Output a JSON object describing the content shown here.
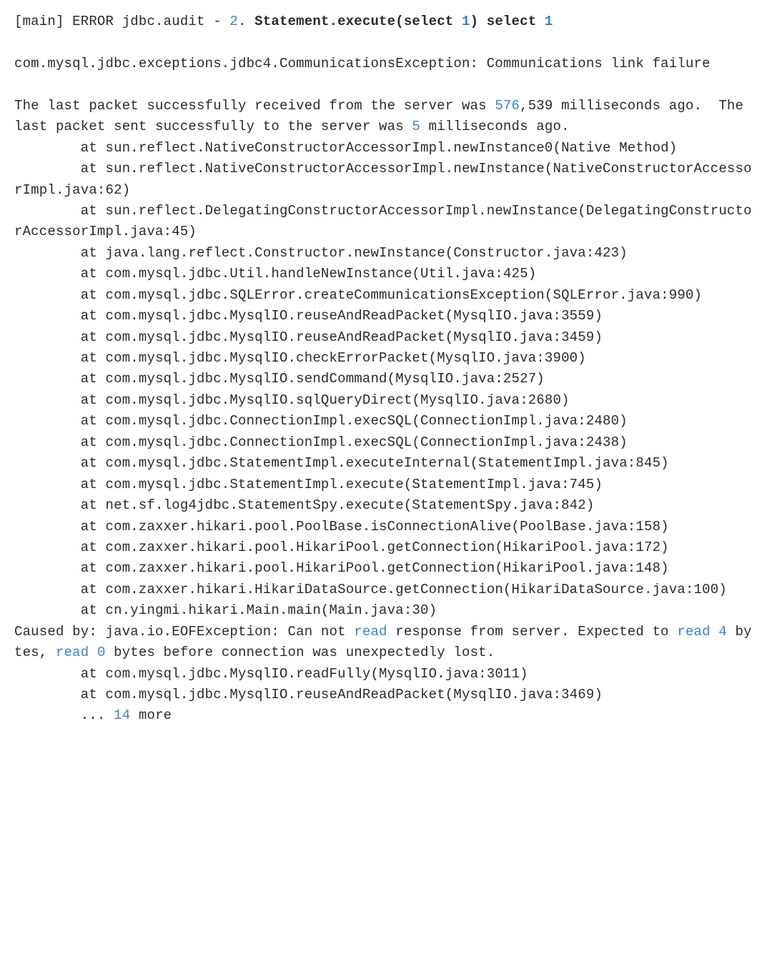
{
  "log": {
    "header": {
      "prefix": "[main] ERROR jdbc.audit - ",
      "num": "2",
      "dot_space": ". ",
      "stmt1": "Statement.execute(select ",
      "one1": "1",
      "close_paren_space": ") ",
      "select_bold": "select ",
      "one2": "1"
    },
    "blank1": "",
    "exception": "com.mysql.jdbc.exceptions.jdbc4.CommunicationsException: Communications link failure",
    "blank2": "",
    "packet": {
      "p1": "The last packet successfully received from the server was ",
      "n1": "576",
      "p2": ",539 milliseconds ago.  The last packet sent successfully to the server was ",
      "n2": "5",
      "p3": " milliseconds ago."
    },
    "stack": [
      "        at sun.reflect.NativeConstructorAccessorImpl.newInstance0(Native Method)",
      "        at sun.reflect.NativeConstructorAccessorImpl.newInstance(NativeConstructorAccessorImpl.java:62)",
      "        at sun.reflect.DelegatingConstructorAccessorImpl.newInstance(DelegatingConstructorAccessorImpl.java:45)",
      "        at java.lang.reflect.Constructor.newInstance(Constructor.java:423)",
      "        at com.mysql.jdbc.Util.handleNewInstance(Util.java:425)",
      "        at com.mysql.jdbc.SQLError.createCommunicationsException(SQLError.java:990)",
      "        at com.mysql.jdbc.MysqlIO.reuseAndReadPacket(MysqlIO.java:3559)",
      "        at com.mysql.jdbc.MysqlIO.reuseAndReadPacket(MysqlIO.java:3459)",
      "        at com.mysql.jdbc.MysqlIO.checkErrorPacket(MysqlIO.java:3900)",
      "        at com.mysql.jdbc.MysqlIO.sendCommand(MysqlIO.java:2527)",
      "        at com.mysql.jdbc.MysqlIO.sqlQueryDirect(MysqlIO.java:2680)",
      "        at com.mysql.jdbc.ConnectionImpl.execSQL(ConnectionImpl.java:2480)",
      "        at com.mysql.jdbc.ConnectionImpl.execSQL(ConnectionImpl.java:2438)",
      "        at com.mysql.jdbc.StatementImpl.executeInternal(StatementImpl.java:845)",
      "        at com.mysql.jdbc.StatementImpl.execute(StatementImpl.java:745)",
      "        at net.sf.log4jdbc.StatementSpy.execute(StatementSpy.java:842)",
      "        at com.zaxxer.hikari.pool.PoolBase.isConnectionAlive(PoolBase.java:158)",
      "        at com.zaxxer.hikari.pool.HikariPool.getConnection(HikariPool.java:172)",
      "        at com.zaxxer.hikari.pool.HikariPool.getConnection(HikariPool.java:148)",
      "        at com.zaxxer.hikari.HikariDataSource.getConnection(HikariDataSource.java:100)",
      "        at cn.yingmi.hikari.Main.main(Main.java:30)"
    ],
    "cause": {
      "p1": "Caused by: java.io.EOFException: Can not ",
      "kw1": "read",
      "p2": " response from server. Expected to ",
      "kw2": "read",
      "sp": " ",
      "n1": "4",
      "p3": " bytes, ",
      "kw3": "read",
      "sp2": " ",
      "n2": "0",
      "p4": " bytes before connection was unexpectedly lost."
    },
    "cause_stack": [
      "        at com.mysql.jdbc.MysqlIO.readFully(MysqlIO.java:3011)",
      "        at com.mysql.jdbc.MysqlIO.reuseAndReadPacket(MysqlIO.java:3469)"
    ],
    "more": {
      "prefix": "        ... ",
      "n": "14",
      "suffix": " more"
    }
  }
}
